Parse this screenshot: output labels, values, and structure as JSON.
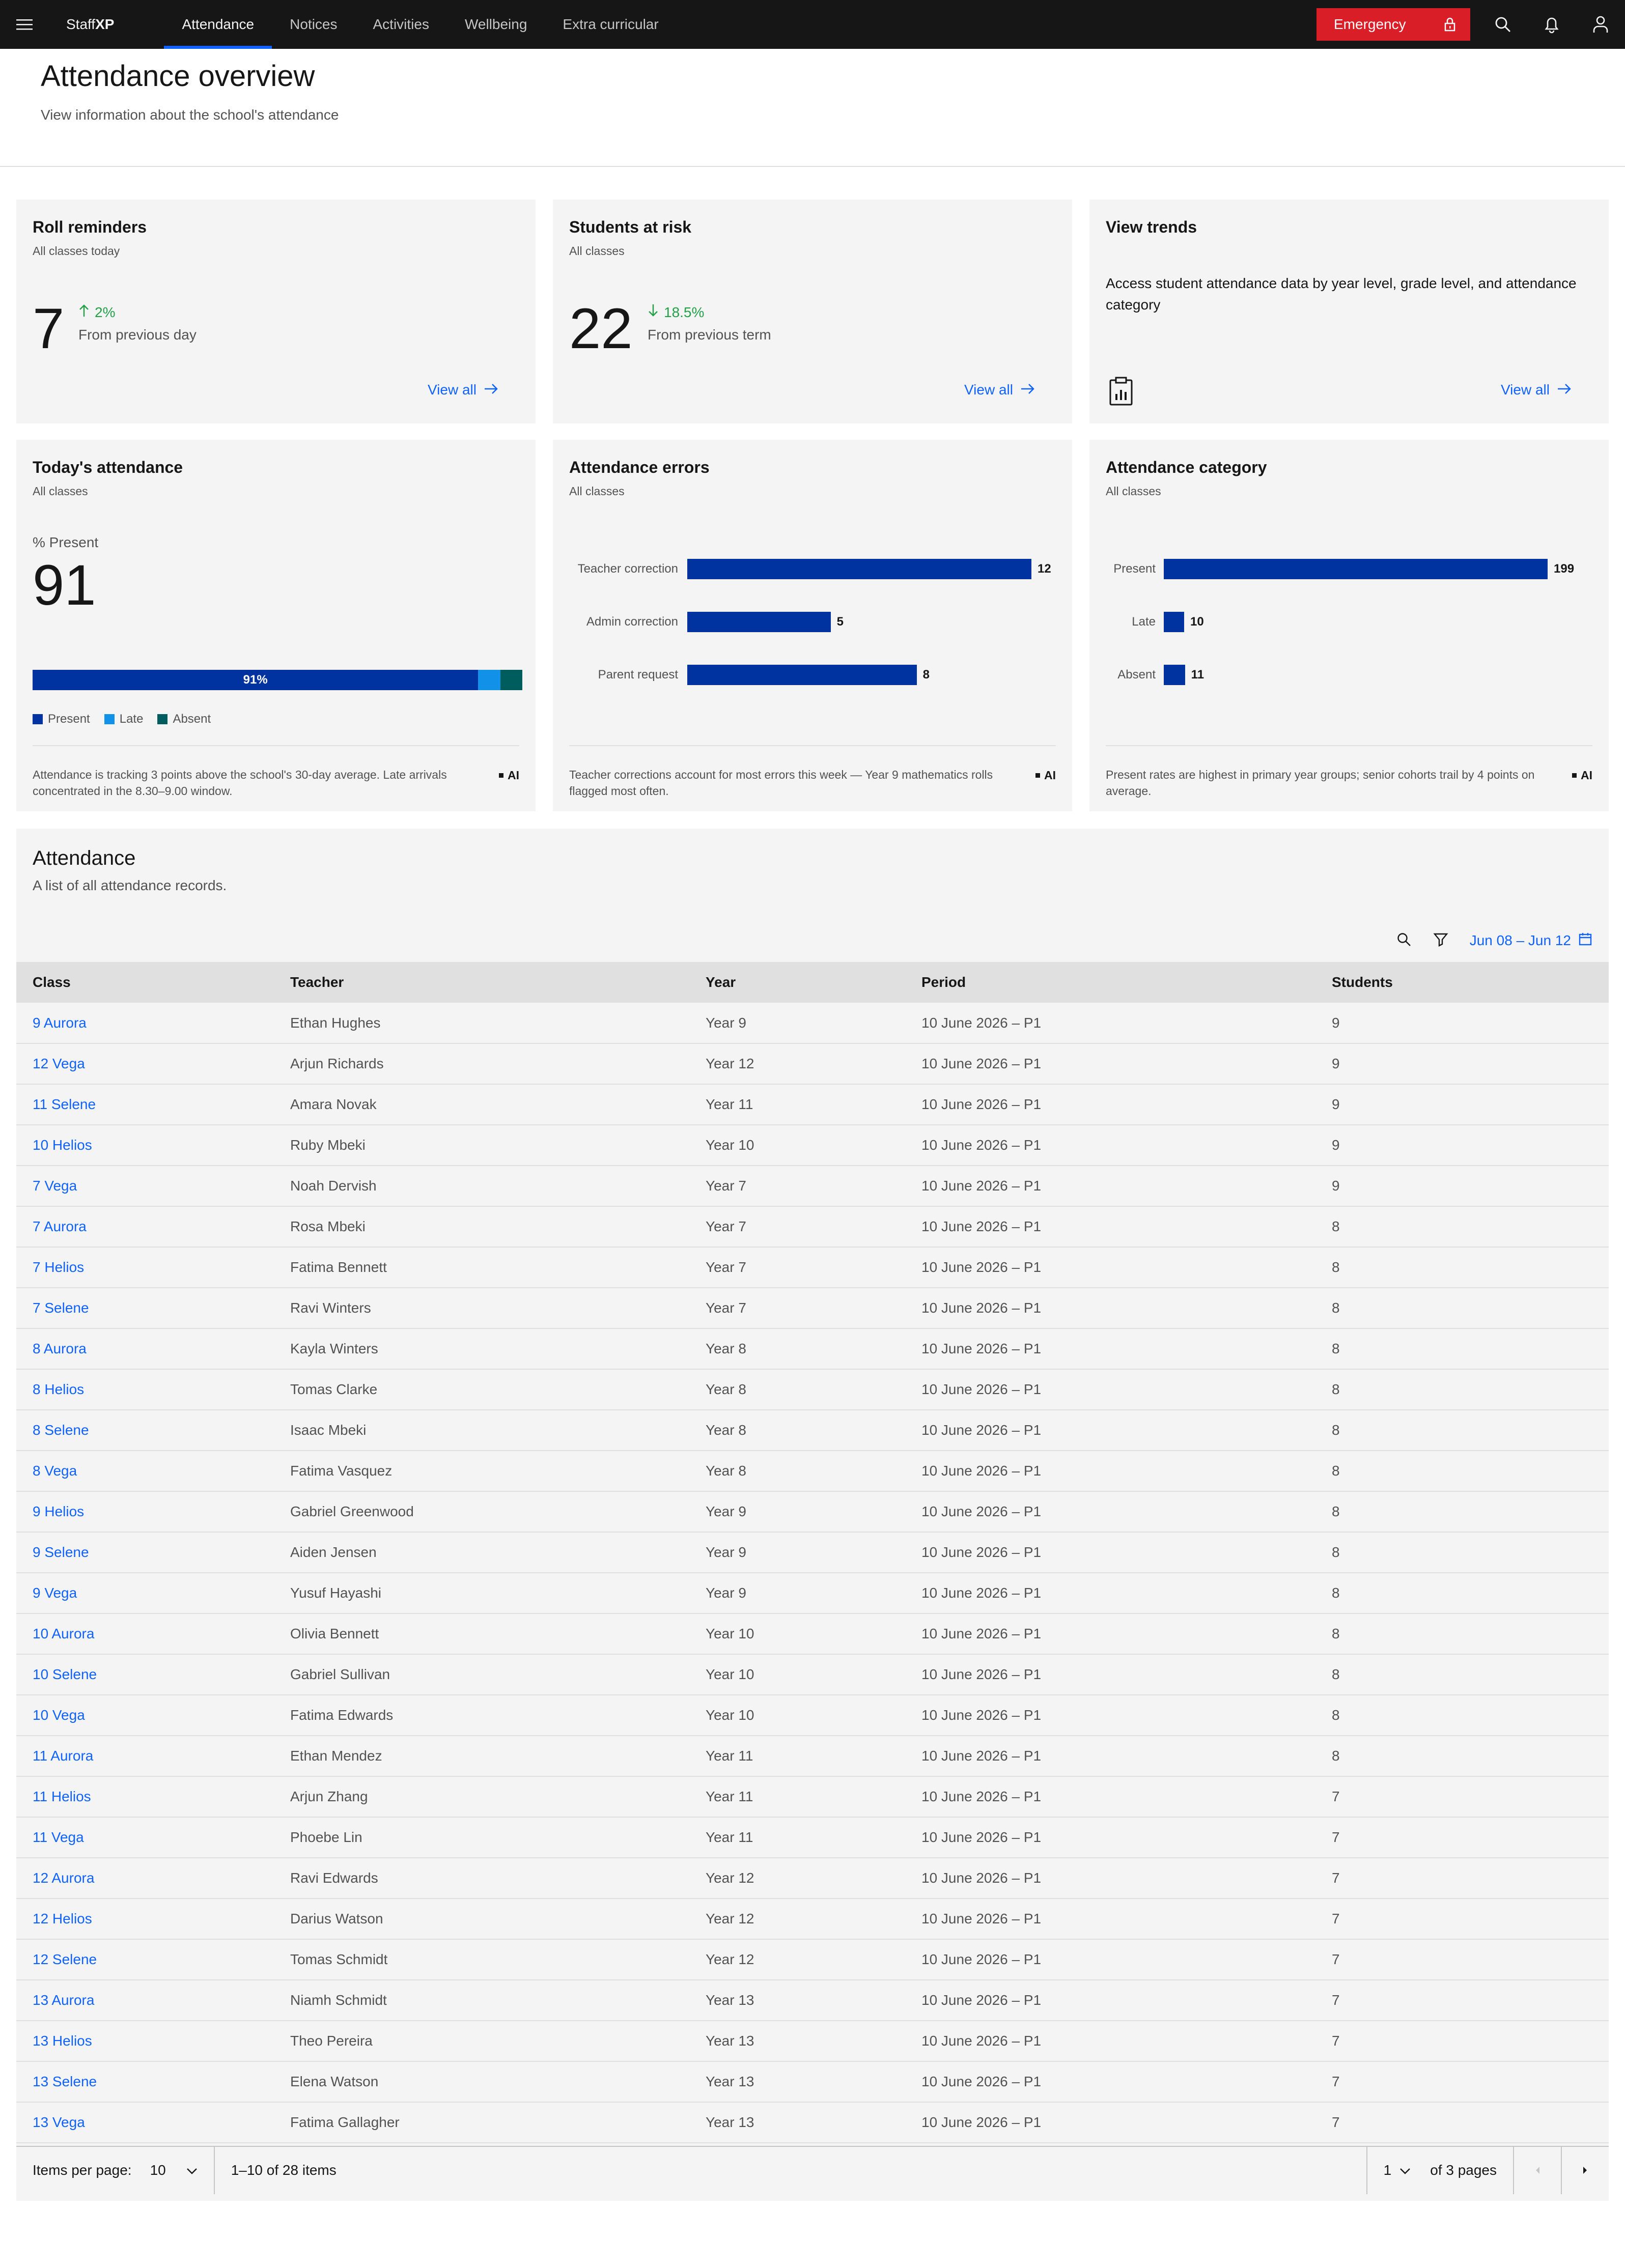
{
  "nav": {
    "brand_prefix": "Staff",
    "brand_suffix": "XP",
    "items": [
      {
        "label": "Attendance",
        "active": true
      },
      {
        "label": "Notices",
        "active": false
      },
      {
        "label": "Activities",
        "active": false
      },
      {
        "label": "Wellbeing",
        "active": false
      },
      {
        "label": "Extra curricular",
        "active": false
      }
    ],
    "emergency_label": "Emergency"
  },
  "header": {
    "title": "Attendance overview",
    "subtitle": "View information about the school's attendance"
  },
  "cards": {
    "roll": {
      "title": "Roll reminders",
      "subtitle": "All classes today",
      "value": "7",
      "trend": "2%",
      "trend_dir": "up",
      "trend_sub": "From previous day",
      "link": "View all"
    },
    "risk": {
      "title": "Students at risk",
      "subtitle": "All classes",
      "value": "22",
      "trend": "18.5%",
      "trend_dir": "down",
      "trend_sub": "From previous term",
      "link": "View all"
    },
    "trends": {
      "title": "View trends",
      "description": "Access student attendance data by year level, grade level, and attendance category",
      "link": "View all"
    },
    "today": {
      "title": "Today's attendance",
      "subtitle": "All classes",
      "metric_label": "% Present",
      "value": "91",
      "bar_label": "91%",
      "segments": [
        {
          "name": "Present",
          "pct": 91,
          "color": "#0032a0"
        },
        {
          "name": "Late",
          "pct": 4.5,
          "color": "#1192e8"
        },
        {
          "name": "Absent",
          "pct": 4.5,
          "color": "#005d5d"
        }
      ],
      "note": "Attendance is tracking 3 points above the school's 30-day average. Late arrivals concentrated in the 8.30–9.00 window.",
      "ai": "AI"
    },
    "errors": {
      "title": "Attendance errors",
      "subtitle": "All classes",
      "note": "Teacher corrections account for most errors this week — Year 9 mathematics rolls flagged most often.",
      "ai": "AI"
    },
    "category": {
      "title": "Attendance category",
      "subtitle": "All classes",
      "note": "Present rates are highest in primary year groups; senior cohorts trail by 4 points on average.",
      "ai": "AI"
    }
  },
  "chart_data": [
    {
      "type": "bar",
      "orientation": "horizontal",
      "categories": [
        "Teacher correction",
        "Admin correction",
        "Parent request"
      ],
      "values": [
        12,
        5,
        8
      ],
      "xlim": [
        0,
        12
      ]
    },
    {
      "type": "bar",
      "orientation": "horizontal",
      "categories": [
        "Present",
        "Late",
        "Absent"
      ],
      "values": [
        199,
        10,
        11
      ],
      "xlim": [
        0,
        199
      ]
    }
  ],
  "table": {
    "title": "Attendance",
    "subtitle": "A list of all attendance records.",
    "date_range": "Jun 08 – Jun 12",
    "columns": [
      "Class",
      "Teacher",
      "Year",
      "Period",
      "Students"
    ],
    "rows": [
      [
        "9 Aurora",
        "Ethan Hughes",
        "Year 9",
        "10 June 2026 – P1",
        "9"
      ],
      [
        "12 Vega",
        "Arjun Richards",
        "Year 12",
        "10 June 2026 – P1",
        "9"
      ],
      [
        "11 Selene",
        "Amara Novak",
        "Year 11",
        "10 June 2026 – P1",
        "9"
      ],
      [
        "10 Helios",
        "Ruby Mbeki",
        "Year 10",
        "10 June 2026 – P1",
        "9"
      ],
      [
        "7 Vega",
        "Noah Dervish",
        "Year 7",
        "10 June 2026 – P1",
        "9"
      ],
      [
        "7 Aurora",
        "Rosa Mbeki",
        "Year 7",
        "10 June 2026 – P1",
        "8"
      ],
      [
        "7 Helios",
        "Fatima Bennett",
        "Year 7",
        "10 June 2026 – P1",
        "8"
      ],
      [
        "7 Selene",
        "Ravi Winters",
        "Year 7",
        "10 June 2026 – P1",
        "8"
      ],
      [
        "8 Aurora",
        "Kayla Winters",
        "Year 8",
        "10 June 2026 – P1",
        "8"
      ],
      [
        "8 Helios",
        "Tomas Clarke",
        "Year 8",
        "10 June 2026 – P1",
        "8"
      ],
      [
        "8 Selene",
        "Isaac Mbeki",
        "Year 8",
        "10 June 2026 – P1",
        "8"
      ],
      [
        "8 Vega",
        "Fatima Vasquez",
        "Year 8",
        "10 June 2026 – P1",
        "8"
      ],
      [
        "9 Helios",
        "Gabriel Greenwood",
        "Year 9",
        "10 June 2026 – P1",
        "8"
      ],
      [
        "9 Selene",
        "Aiden Jensen",
        "Year 9",
        "10 June 2026 – P1",
        "8"
      ],
      [
        "9 Vega",
        "Yusuf Hayashi",
        "Year 9",
        "10 June 2026 – P1",
        "8"
      ],
      [
        "10 Aurora",
        "Olivia Bennett",
        "Year 10",
        "10 June 2026 – P1",
        "8"
      ],
      [
        "10 Selene",
        "Gabriel Sullivan",
        "Year 10",
        "10 June 2026 – P1",
        "8"
      ],
      [
        "10 Vega",
        "Fatima Edwards",
        "Year 10",
        "10 June 2026 – P1",
        "8"
      ],
      [
        "11 Aurora",
        "Ethan Mendez",
        "Year 11",
        "10 June 2026 – P1",
        "8"
      ],
      [
        "11 Helios",
        "Arjun Zhang",
        "Year 11",
        "10 June 2026 – P1",
        "7"
      ],
      [
        "11 Vega",
        "Phoebe Lin",
        "Year 11",
        "10 June 2026 – P1",
        "7"
      ],
      [
        "12 Aurora",
        "Ravi Edwards",
        "Year 12",
        "10 June 2026 – P1",
        "7"
      ],
      [
        "12 Helios",
        "Darius Watson",
        "Year 12",
        "10 June 2026 – P1",
        "7"
      ],
      [
        "12 Selene",
        "Tomas Schmidt",
        "Year 12",
        "10 June 2026 – P1",
        "7"
      ],
      [
        "13 Aurora",
        "Niamh Schmidt",
        "Year 13",
        "10 June 2026 – P1",
        "7"
      ],
      [
        "13 Helios",
        "Theo Pereira",
        "Year 13",
        "10 June 2026 – P1",
        "7"
      ],
      [
        "13 Selene",
        "Elena Watson",
        "Year 13",
        "10 June 2026 – P1",
        "7"
      ],
      [
        "13 Vega",
        "Fatima Gallagher",
        "Year 13",
        "10 June 2026 – P1",
        "7"
      ]
    ]
  },
  "pagination": {
    "items_per_page_label": "Items per page:",
    "items_per_page": "10",
    "range": "1–10 of 28 items",
    "page": "1",
    "of_pages": "of 3 pages"
  },
  "colors": {
    "accent": "#0f62fe",
    "bar": "#0032a0",
    "emergency": "#da1e28",
    "success": "#24a148"
  }
}
